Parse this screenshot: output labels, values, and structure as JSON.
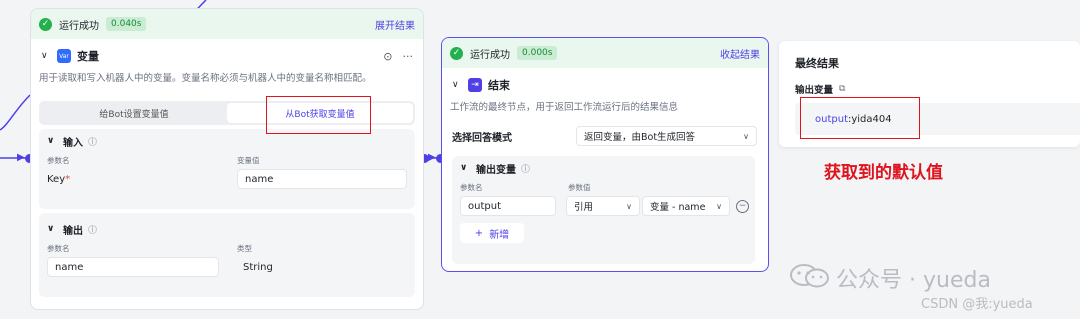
{
  "left_node": {
    "status": "运行成功",
    "time": "0.040s",
    "expand": "展开结果",
    "badge": "Var",
    "title": "变量",
    "desc": "用于读取和写入机器人中的变量。变量名称必须与机器人中的变量名称相匹配。",
    "tabs": [
      "给Bot设置变量值",
      "从Bot获取变量值"
    ],
    "input": {
      "label": "输入",
      "col_name": "参数名",
      "col_value": "变量值",
      "param_name": "Key",
      "param_required": "*",
      "param_value": "name"
    },
    "output": {
      "label": "输出",
      "col_name": "参数名",
      "col_type": "类型",
      "param_name": "name",
      "param_type": "String"
    }
  },
  "mid_node": {
    "status": "运行成功",
    "time": "0.000s",
    "collapse": "收起结果",
    "title": "结束",
    "desc": "工作流的最终节点，用于返回工作流运行后的结果信息",
    "mode_label": "选择回答模式",
    "mode_value": "返回变量，由Bot生成回答",
    "output": {
      "label": "输出变量",
      "col_name": "参数名",
      "col_value": "参数值",
      "param_name": "output",
      "ref_type": "引用",
      "ref_value": "变量 - name",
      "add": "新增"
    }
  },
  "result": {
    "title": "最终结果",
    "sub": "输出变量",
    "key": "output",
    "sep": " : ",
    "value": "yida404"
  },
  "annotation": "获取到的默认值",
  "watermark": {
    "main": "公众号 · yueda",
    "csdn": "CSDN @我:yueda"
  },
  "colors": {
    "accent": "#4e40e5",
    "success": "#22b14c",
    "annotation_red": "#e0141e"
  }
}
